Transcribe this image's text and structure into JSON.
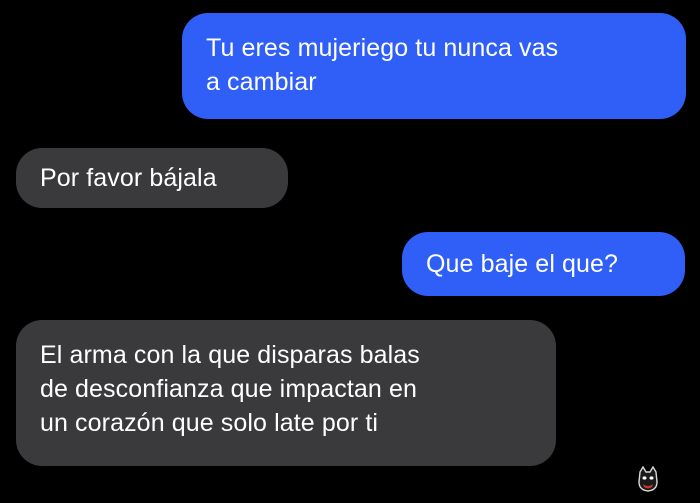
{
  "conversation": {
    "messages": [
      {
        "sender": "me",
        "lines": [
          "Tu eres mujeriego tu nunca vas",
          "a cambiar"
        ]
      },
      {
        "sender": "them",
        "lines": [
          "Por favor bájala"
        ]
      },
      {
        "sender": "me",
        "lines": [
          "Que baje el que?"
        ]
      },
      {
        "sender": "them",
        "lines": [
          "El arma con la que disparas balas",
          "de desconfianza que impactan en",
          "un corazón que solo late por ti"
        ]
      }
    ]
  },
  "colors": {
    "background": "#000000",
    "sent_bubble": "#2f5ff7",
    "received_bubble": "#3a3a3c",
    "text": "#ffffff"
  },
  "watermark": {
    "icon": "cat-face-icon"
  }
}
